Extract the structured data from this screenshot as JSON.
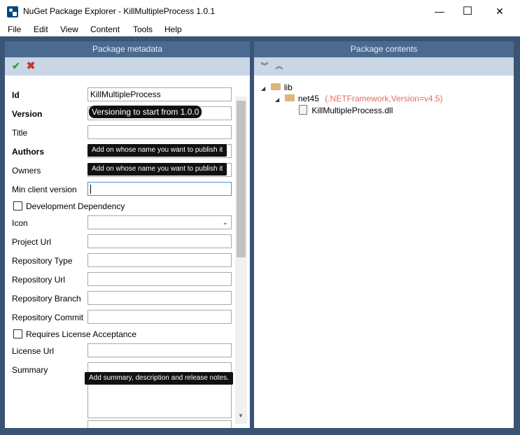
{
  "window": {
    "title": "NuGet Package Explorer - KillMultipleProcess 1.0.1",
    "minimize_glyph": "—",
    "maximize_glyph": "☐",
    "close_glyph": "✕"
  },
  "menu": [
    "File",
    "Edit",
    "View",
    "Content",
    "Tools",
    "Help"
  ],
  "left_panel": {
    "header": "Package metadata",
    "icons": {
      "accept": "check-icon",
      "cancel": "cross-icon"
    },
    "fields": {
      "id": {
        "label": "Id",
        "value": "KillMultipleProcess"
      },
      "version": {
        "label": "Version",
        "tooltip": "Versioning to start from 1.0.0"
      },
      "title": {
        "label": "Title",
        "value": ""
      },
      "authors": {
        "label": "Authors",
        "tooltip": "Add on whose name you want to publish it"
      },
      "owners": {
        "label": "Owners",
        "tooltip": "Add on whose name you want to publish it"
      },
      "min_client_version": {
        "label": "Min client version",
        "value": ""
      },
      "development_dependency": {
        "label": "Development Dependency"
      },
      "icon": {
        "label": "Icon",
        "value": ""
      },
      "project_url": {
        "label": "Project Url",
        "value": ""
      },
      "repository_type": {
        "label": "Repository Type",
        "value": ""
      },
      "repository_url": {
        "label": "Repository Url",
        "value": ""
      },
      "repository_branch": {
        "label": "Repository Branch",
        "value": ""
      },
      "repository_commit": {
        "label": "Repository Commit",
        "value": ""
      },
      "requires_license_acceptance": {
        "label": "Requires License Acceptance"
      },
      "license_url": {
        "label": "License Url",
        "value": ""
      },
      "summary": {
        "label": "Summary",
        "tooltip": "Add summary, description and release notes."
      }
    }
  },
  "right_panel": {
    "header": "Package contents",
    "icons": {
      "expand_all": "expand-all-icon",
      "collapse_all": "collapse-all-icon"
    },
    "tree": {
      "root": {
        "label": "lib"
      },
      "child": {
        "label": "net45",
        "framework": "(.NETFramework,Version=v4.5)"
      },
      "file": {
        "label": "KillMultipleProcess.dll"
      }
    }
  },
  "colors": {
    "frame": "#3a5474",
    "panel_header": "#4b6a8f",
    "toolbar": "#c9d6e6",
    "framework_text": "#e06c60",
    "accept_green": "#3a9a3a",
    "cancel_red": "#c0392b"
  }
}
